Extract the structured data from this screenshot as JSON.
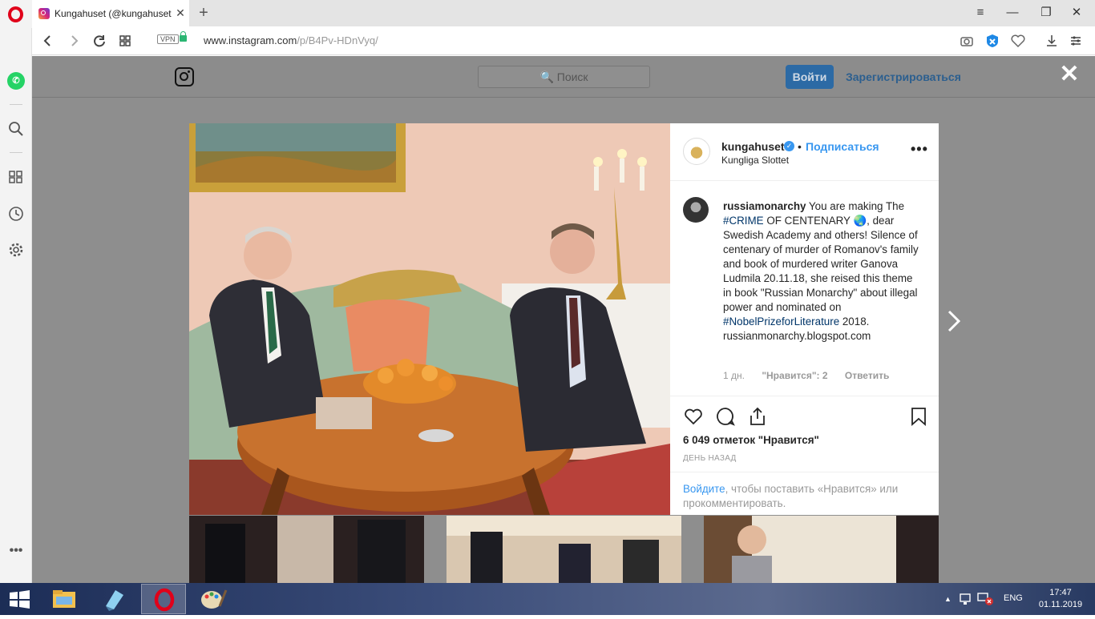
{
  "browser": {
    "tab_title": "Kungahuset (@kungahuset",
    "tab_close": "✕",
    "new_tab": "+",
    "url_host": "www.instagram.com",
    "url_path": "/p/B4Pv-HDnVyq/",
    "vpn_label": "VPN",
    "window_controls": {
      "menu": "≡",
      "minimize": "—",
      "restore": "❐",
      "close": "✕"
    }
  },
  "instagram": {
    "search_placeholder": "🔍 Поиск",
    "login_button": "Войти",
    "signup_link": "Зарегистрироваться",
    "close_symbol": "✕"
  },
  "post": {
    "author": "kungahuset",
    "verified_mark": "✓",
    "separator": "•",
    "follow_label": "Подписаться",
    "location": "Kungliga Slottet",
    "more_symbol": "•••",
    "comment": {
      "username": "russiamonarchy",
      "text_1": " You are making The ",
      "hashtag_1": "#CRIME",
      "text_2": " OF CENTENARY 🌏, dear Swedish Academy and others! Silence of centenary of murder of Romanov's family and book of murdered writer Ganova Ludmila 20.11.18, she reised this theme in book \"Russian Monarchy\" about illegal power and nominated on ",
      "hashtag_2": "#NobelPrizeforLiterature",
      "text_3": " 2018. russianmonarchy.blogspot.com",
      "age": "1 дн.",
      "likes": "\"Нравится\": 2",
      "reply": "Ответить"
    },
    "likes_count": "6 049 отметок \"Нравится\"",
    "posted_ago": "ДЕНЬ НАЗАД",
    "login_link": "Войдите",
    "login_text": ", чтобы поставить «Нравится» или прокомментировать."
  },
  "taskbar": {
    "language": "ENG",
    "time": "17:47",
    "date": "01.11.2019",
    "tray_arrow": "▲"
  }
}
